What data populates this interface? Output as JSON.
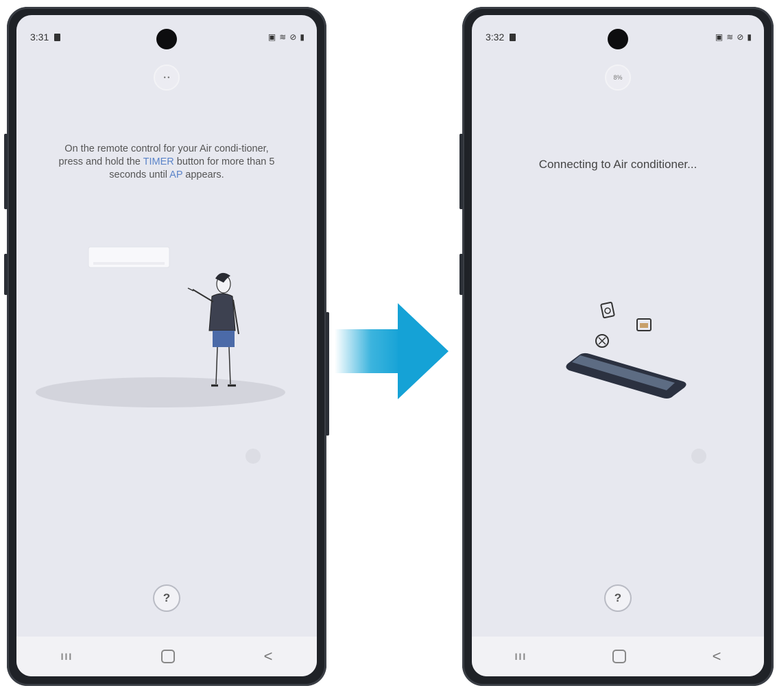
{
  "left_phone": {
    "status_time": "3:31",
    "instruction_part1": "On the remote control for your Air condi-tioner, press and hold the ",
    "instruction_timer": "TIMER",
    "instruction_part2": " button for more than 5 seconds until ",
    "instruction_ap": "AP",
    "instruction_part3": " appears.",
    "help_label": "?"
  },
  "right_phone": {
    "status_time": "3:32",
    "progress_label": "8%",
    "connecting_text": "Connecting to Air conditioner...",
    "help_label": "?"
  },
  "navbar": {
    "recent_label": "III",
    "back_label": "<"
  },
  "colors": {
    "screen_bg": "#e7e8ef",
    "highlight": "#5b84c9",
    "arrow": "#1aa7d8"
  }
}
